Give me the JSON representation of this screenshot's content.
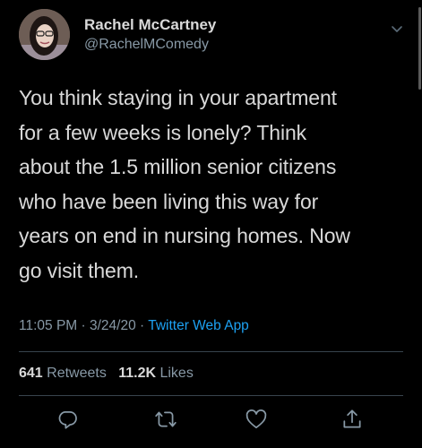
{
  "author": {
    "display_name": "Rachel McCartney",
    "handle": "@RachelMComedy"
  },
  "tweet": {
    "lines": [
      "You think staying in your apartment",
      "for a few weeks is lonely? Think",
      "about the 1.5 million senior citizens",
      "who have been living this way for",
      "years on end in nursing homes. Now",
      "go visit them."
    ],
    "time": "11:05 PM",
    "date": "3/24/20",
    "separator": "·",
    "source": "Twitter Web App"
  },
  "stats": {
    "retweets_count": "641",
    "retweets_label": "Retweets",
    "likes_count": "11.2K",
    "likes_label": "Likes"
  },
  "icons": {
    "more": "chevron-down-icon",
    "reply": "reply-icon",
    "retweet": "retweet-icon",
    "like": "heart-icon",
    "share": "share-icon"
  },
  "colors": {
    "background": "#000000",
    "text": "#d9d9d9",
    "muted": "#8899a6",
    "accent": "#1da1f2",
    "divider": "#38444d"
  }
}
